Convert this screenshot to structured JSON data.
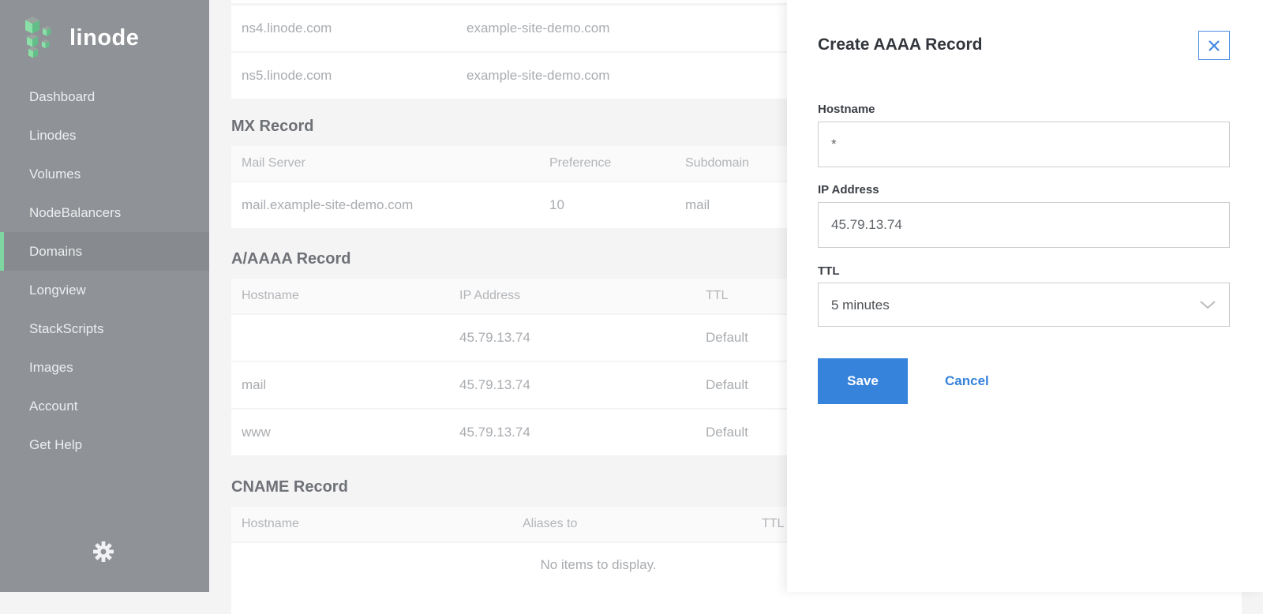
{
  "colors": {
    "accent_blue": "#3683dc",
    "sidebar_gray": "#8f9297",
    "active_green": "#7ed6a0"
  },
  "icons": {
    "logo": "linode-cubes-logo",
    "gear": "gear-icon",
    "close": "close-icon",
    "chevron": "chevron-down-icon"
  },
  "brand": {
    "logo_text": "linode"
  },
  "sidebar": {
    "items": [
      {
        "label": "Dashboard",
        "active": false
      },
      {
        "label": "Linodes",
        "active": false
      },
      {
        "label": "Volumes",
        "active": false
      },
      {
        "label": "NodeBalancers",
        "active": false
      },
      {
        "label": "Domains",
        "active": true
      },
      {
        "label": "Longview",
        "active": false
      },
      {
        "label": "StackScripts",
        "active": false
      },
      {
        "label": "Images",
        "active": false
      },
      {
        "label": "Account",
        "active": false
      },
      {
        "label": "Get Help",
        "active": false
      }
    ]
  },
  "main": {
    "ns_rows": [
      {
        "name": "ns4.linode.com",
        "target": "example-site-demo.com"
      },
      {
        "name": "ns5.linode.com",
        "target": "example-site-demo.com"
      }
    ],
    "mx": {
      "title": "MX Record",
      "headers": [
        "Mail Server",
        "Preference",
        "Subdomain"
      ],
      "rows": [
        {
          "server": "mail.example-site-demo.com",
          "preference": "10",
          "subdomain": "mail"
        }
      ]
    },
    "a_aaaa": {
      "title": "A/AAAA Record",
      "headers": [
        "Hostname",
        "IP Address",
        "TTL"
      ],
      "rows": [
        {
          "hostname": "",
          "ip": "45.79.13.74",
          "ttl": "Default"
        },
        {
          "hostname": "mail",
          "ip": "45.79.13.74",
          "ttl": "Default"
        },
        {
          "hostname": "www",
          "ip": "45.79.13.74",
          "ttl": "Default"
        }
      ]
    },
    "cname": {
      "title": "CNAME Record",
      "headers": [
        "Hostname",
        "Aliases to",
        "TTL"
      ],
      "empty": "No items to display."
    }
  },
  "drawer": {
    "title": "Create AAAA Record",
    "hostname": {
      "label": "Hostname",
      "value": "*"
    },
    "ip": {
      "label": "IP Address",
      "value": "45.79.13.74"
    },
    "ttl": {
      "label": "TTL",
      "value": "5 minutes"
    },
    "save": "Save",
    "cancel": "Cancel"
  }
}
